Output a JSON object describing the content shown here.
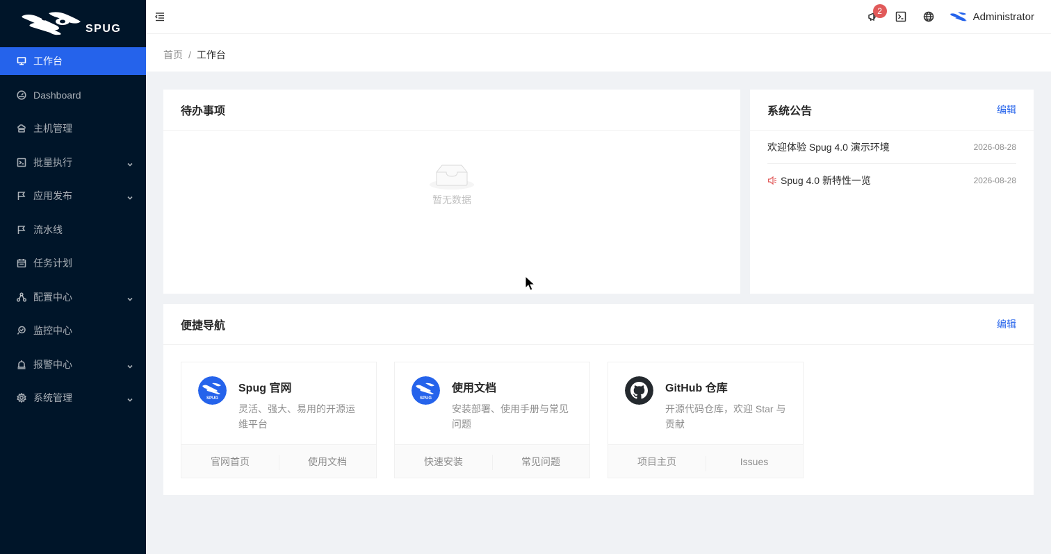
{
  "sidebar": {
    "brand": "SPUG",
    "items": [
      {
        "label": "工作台",
        "icon": "desktop-icon",
        "active": true,
        "submenu": false
      },
      {
        "label": "Dashboard",
        "icon": "dashboard-icon",
        "active": false,
        "submenu": false
      },
      {
        "label": "主机管理",
        "icon": "cloud-server-icon",
        "active": false,
        "submenu": false
      },
      {
        "label": "批量执行",
        "icon": "code-icon",
        "active": false,
        "submenu": true
      },
      {
        "label": "应用发布",
        "icon": "flag-icon",
        "active": false,
        "submenu": true
      },
      {
        "label": "流水线",
        "icon": "flag-icon",
        "active": false,
        "submenu": false
      },
      {
        "label": "任务计划",
        "icon": "schedule-icon",
        "active": false,
        "submenu": false
      },
      {
        "label": "配置中心",
        "icon": "deployment-icon",
        "active": false,
        "submenu": true
      },
      {
        "label": "监控中心",
        "icon": "monitor-icon",
        "active": false,
        "submenu": false
      },
      {
        "label": "报警中心",
        "icon": "alert-icon",
        "active": false,
        "submenu": true
      },
      {
        "label": "系统管理",
        "icon": "setting-icon",
        "active": false,
        "submenu": true
      }
    ]
  },
  "header": {
    "notification_count": "2",
    "user_name": "Administrator"
  },
  "breadcrumb": {
    "home": "首页",
    "separator": "/",
    "current": "工作台"
  },
  "todo": {
    "title": "待办事项",
    "empty_text": "暂无数据"
  },
  "notice": {
    "title": "系统公告",
    "edit_label": "编辑",
    "items": [
      {
        "title": "欢迎体验 Spug 4.0 演示环境",
        "date": "2026-08-28",
        "icon": ""
      },
      {
        "title": "Spug 4.0 新特性一览",
        "date": "2026-08-28",
        "icon": "sound-icon"
      }
    ]
  },
  "nav": {
    "title": "便捷导航",
    "edit_label": "编辑",
    "cards": [
      {
        "title": "Spug 官网",
        "desc": "灵活、强大、易用的开源运维平台",
        "logo": "spug-logo-icon",
        "actions": [
          "官网首页",
          "使用文档"
        ]
      },
      {
        "title": "使用文档",
        "desc": "安装部署、使用手册与常见问题",
        "logo": "spug-logo-icon",
        "actions": [
          "快速安装",
          "常见问题"
        ]
      },
      {
        "title": "GitHub 仓库",
        "desc": "开源代码仓库，欢迎 Star 与贡献",
        "logo": "github-icon",
        "actions": [
          "项目主页",
          "Issues"
        ]
      }
    ]
  },
  "colors": {
    "primary": "#2563eb",
    "sidebar_bg": "#001529",
    "badge": "#e15a5a"
  }
}
